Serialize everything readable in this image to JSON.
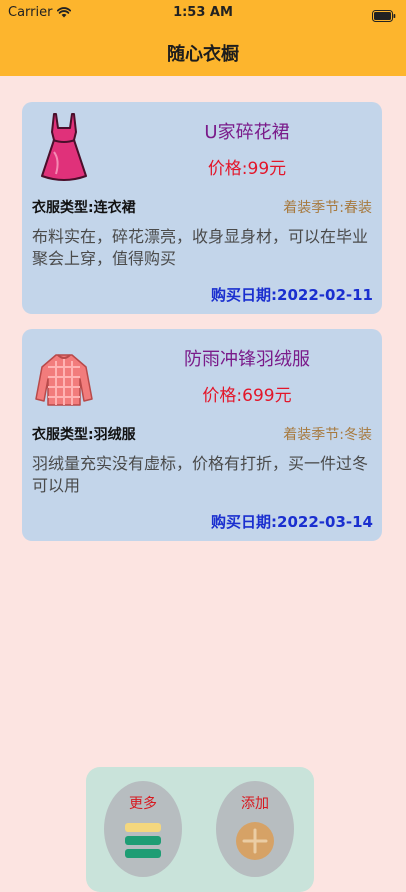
{
  "status_bar": {
    "carrier": "Carrier",
    "time": "1:53 AM"
  },
  "nav": {
    "title": "随心衣橱"
  },
  "items": [
    {
      "icon": "dress-icon",
      "name": "U家碎花裙",
      "price": "价格:99元",
      "type": "衣服类型:连衣裙",
      "season": "着装季节:春装",
      "description": "布料实在，碎花漂亮，收身显身材，可以在毕业聚会上穿，值得购买",
      "date": "购买日期:2022-02-11"
    },
    {
      "icon": "down-jacket-icon",
      "name": "防雨冲锋羽绒服",
      "price": "价格:699元",
      "type": "衣服类型:羽绒服",
      "season": "着装季节:冬装",
      "description": "羽绒量充实没有虚标，价格有打折，买一件过冬可以用",
      "date": "购买日期:2022-03-14"
    }
  ],
  "toolbar": {
    "more_label": "更多",
    "more_icon": "stack-icon",
    "add_label": "添加",
    "add_icon": "plus-circle-icon"
  },
  "colors": {
    "header": "#FDB52D",
    "background": "#FCE4E1",
    "card": "#C3D5EA",
    "name": "#7A1B8A",
    "price": "#E3162A",
    "season": "#A77A3F",
    "date": "#1A2FCF",
    "toolbar": "#C9E3DA"
  }
}
